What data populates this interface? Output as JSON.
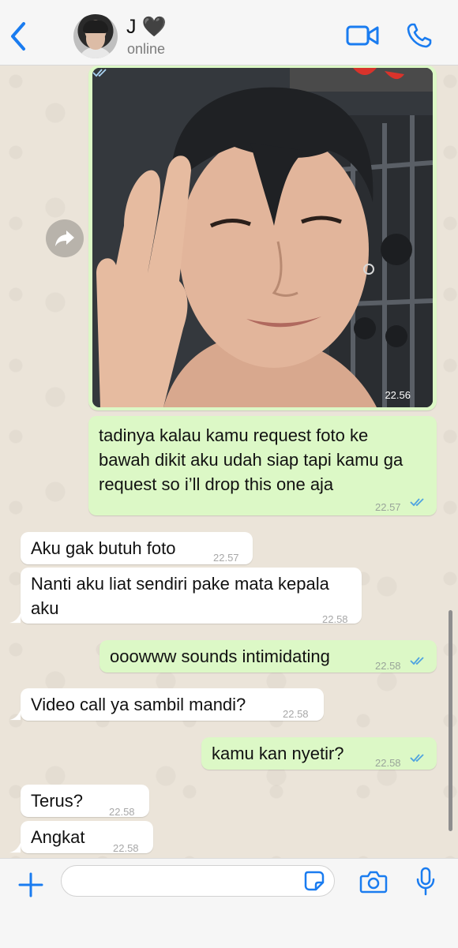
{
  "header": {
    "contact_name": "J 🖤",
    "status": "online",
    "back_icon": "chevron-left-icon",
    "video_icon": "video-call-icon",
    "phone_icon": "phone-icon",
    "accent_color": "#1a7cf0"
  },
  "messages": {
    "image": {
      "time": "22.56",
      "status": "read"
    },
    "m1": {
      "text": "tadinya kalau kamu request foto ke\nbawah dikit aku udah siap tapi kamu ga\nrequest so i’ll drop this one aja",
      "time": "22.57",
      "direction": "out"
    },
    "m2": {
      "text": "Aku gak butuh foto",
      "time": "22.57",
      "direction": "in"
    },
    "m3": {
      "text": "Nanti aku liat sendiri pake mata kepala\naku",
      "time": "22.58",
      "direction": "in"
    },
    "m4": {
      "text": "ooowww sounds intimidating",
      "time": "22.58",
      "direction": "out"
    },
    "m5": {
      "text": "Video call ya sambil mandi?",
      "time": "22.58",
      "direction": "in"
    },
    "m6": {
      "text": "kamu kan nyetir?",
      "time": "22.58",
      "direction": "out"
    },
    "m7": {
      "text": "Terus?",
      "time": "22.58",
      "direction": "in"
    },
    "m8": {
      "text": "Angkat",
      "time": "22.58",
      "direction": "in"
    }
  },
  "input": {
    "placeholder": "",
    "value": ""
  },
  "colors": {
    "outgoing_bubble": "#dcf8c6",
    "incoming_bubble": "#ffffff",
    "read_ticks": "#4fa3e0",
    "background": "#ebe4d9"
  }
}
